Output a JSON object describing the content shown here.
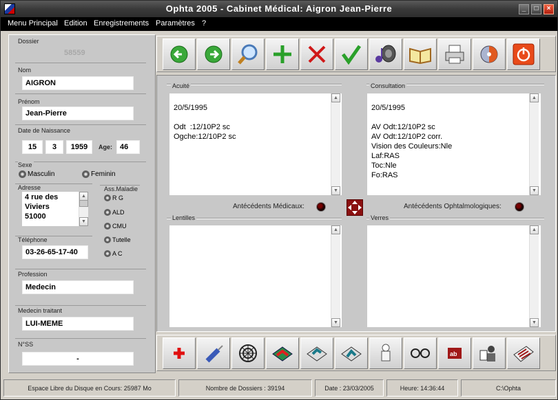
{
  "window": {
    "title": "Ophta 2005 - Cabinet Médical: Aigron Jean-Pierre"
  },
  "menu": [
    {
      "label": "Menu Principal"
    },
    {
      "label": "Edition"
    },
    {
      "label": "Enregistrements"
    },
    {
      "label": "Paramètres"
    },
    {
      "label": "?"
    }
  ],
  "patient": {
    "dossier_label": "Dossier",
    "dossier": "58559",
    "nom_label": "Nom",
    "nom": "AIGRON",
    "prenom_label": "Prénom",
    "prenom": "Jean-Pierre",
    "naissance_label": "Date de Naissance",
    "jour": "15",
    "mois": "3",
    "annee": "1959",
    "age_label": "Age:",
    "age": "46",
    "sexe_label": "Sexe",
    "sexe_options": [
      "Masculin",
      "Feminin"
    ],
    "adresse_label": "Adresse",
    "adresse_lines": [
      "4 rue des",
      "Viviers",
      "51000"
    ],
    "ass_label": "Ass.Maladie",
    "ass_options": [
      "R G",
      "ALD",
      "CMU",
      "Tutelle",
      "A C"
    ],
    "telephone_label": "Téléphone",
    "telephone": "03-26-65-17-40",
    "profession_label": "Profession",
    "profession": "Medecin",
    "medecin_label": "Medecin traitant",
    "medecin": "LUI-MEME",
    "nss_label": "N°SS",
    "nss": "-"
  },
  "toolbar": {
    "icons": [
      "back-arrow-icon",
      "forward-arrow-icon",
      "search-icon",
      "add-icon",
      "delete-icon",
      "validate-icon",
      "speaker-icon",
      "book-icon",
      "print-icon",
      "media-icon",
      "power-icon"
    ]
  },
  "panels": {
    "acuite_label": "Acuité",
    "acuite_lines": [
      "20/5/1995",
      "",
      "Odt  :12/10P2 sc",
      "Ogche:12/10P2 sc"
    ],
    "consultation_label": "Consultation",
    "consultation_lines": [
      "20/5/1995",
      "",
      "AV Odt:12/10P2 sc",
      "AV Odt:12/10P2 corr.",
      "Vision des Couleurs:Nle",
      "Laf:RAS",
      "Toc:Nle",
      "Fo:RAS"
    ],
    "atcd_medicaux_label": "Antécédents Médicaux:",
    "atcd_ophtalmo_label": "Antécédents Ophtalmologiques:",
    "lentilles_label": "Lentilles",
    "verres_label": "Verres"
  },
  "toolbar2": {
    "icons": [
      "red-cross-icon",
      "syringe-icon",
      "target-icon",
      "folder-red-icon",
      "folder-teal-icon",
      "folder-arrow-icon",
      "chef-icon",
      "glasses-icon",
      "ab-label-icon",
      "doctor-icon",
      "keyboard-icon"
    ]
  },
  "status": {
    "disk": "Espace Libre du Disque en Cours: 25987 Mo",
    "dossiers": "Nombre de Dossiers : 39194",
    "date": "Date : 23/03/2005",
    "heure": "Heure: 14:36:44",
    "path": "C:\\Ophta"
  },
  "colors": {
    "titlebar": "#3a3a3a",
    "menubar": "#000000",
    "panel": "#c8c8c8",
    "accent_red": "#cc0000"
  }
}
